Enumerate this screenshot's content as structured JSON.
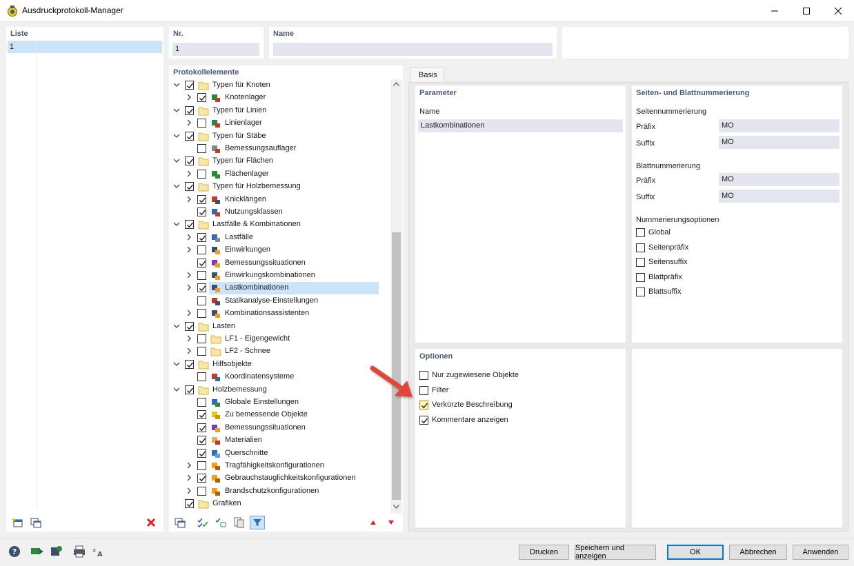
{
  "window": {
    "title": "Ausdruckprotokoll-Manager",
    "minimize_label": "—",
    "maximize_label": "☐",
    "close_label": "✕"
  },
  "liste": {
    "header": "Liste",
    "items": [
      "1"
    ]
  },
  "nr": {
    "header": "Nr.",
    "value": "1"
  },
  "name": {
    "header": "Name",
    "value": ""
  },
  "protokollelemente": {
    "header": "Protokollelemente",
    "tree": [
      {
        "label": "Typen für Knoten",
        "level": 0,
        "expand": "open",
        "checked": true,
        "icon": "folder-icon"
      },
      {
        "label": "Knotenlager",
        "level": 1,
        "expand": "closed",
        "checked": true,
        "icon": "node-support-icon"
      },
      {
        "label": "Typen für Linien",
        "level": 0,
        "expand": "open",
        "checked": true,
        "icon": "folder-icon"
      },
      {
        "label": "Linienlager",
        "level": 1,
        "expand": "closed",
        "checked": false,
        "icon": "line-support-icon"
      },
      {
        "label": "Typen für Stäbe",
        "level": 0,
        "expand": "open",
        "checked": true,
        "icon": "folder-icon"
      },
      {
        "label": "Bemessungsauflager",
        "level": 1,
        "expand": "none",
        "checked": false,
        "icon": "design-support-icon"
      },
      {
        "label": "Typen für Flächen",
        "level": 0,
        "expand": "open",
        "checked": true,
        "icon": "folder-icon"
      },
      {
        "label": "Flächenlager",
        "level": 1,
        "expand": "closed",
        "checked": false,
        "icon": "surface-support-icon"
      },
      {
        "label": "Typen für Holzbemessung",
        "level": 0,
        "expand": "open",
        "checked": true,
        "icon": "folder-icon"
      },
      {
        "label": "Knicklängen",
        "level": 1,
        "expand": "closed",
        "checked": true,
        "icon": "buckling-length-icon"
      },
      {
        "label": "Nutzungsklassen",
        "level": 1,
        "expand": "none",
        "checked": true,
        "icon": "service-class-icon"
      },
      {
        "label": "Lastfälle & Kombinationen",
        "level": 0,
        "expand": "open",
        "checked": true,
        "icon": "folder-icon"
      },
      {
        "label": "Lastfälle",
        "level": 1,
        "expand": "closed",
        "checked": true,
        "icon": "load-case-icon"
      },
      {
        "label": "Einwirkungen",
        "level": 1,
        "expand": "closed",
        "checked": false,
        "icon": "action-icon"
      },
      {
        "label": "Bemessungssituationen",
        "level": 1,
        "expand": "none",
        "checked": true,
        "icon": "design-situation-icon"
      },
      {
        "label": "Einwirkungskombinationen",
        "level": 1,
        "expand": "closed",
        "checked": false,
        "icon": "action-combination-icon"
      },
      {
        "label": "Lastkombinationen",
        "level": 1,
        "expand": "closed",
        "checked": true,
        "icon": "load-combination-icon",
        "selected": true
      },
      {
        "label": "Statikanalyse-Einstellungen",
        "level": 1,
        "expand": "none",
        "checked": false,
        "icon": "static-analysis-icon"
      },
      {
        "label": "Kombinationsassistenten",
        "level": 1,
        "expand": "closed",
        "checked": false,
        "icon": "combination-wizard-icon"
      },
      {
        "label": "Lasten",
        "level": 0,
        "expand": "open",
        "checked": true,
        "icon": "folder-icon"
      },
      {
        "label": "LF1 - Eigengewicht",
        "level": 1,
        "expand": "closed",
        "checked": false,
        "icon": "folder-icon"
      },
      {
        "label": "LF2 - Schnee",
        "level": 1,
        "expand": "closed",
        "checked": false,
        "icon": "folder-icon"
      },
      {
        "label": "Hilfsobjekte",
        "level": 0,
        "expand": "open",
        "checked": true,
        "icon": "folder-icon"
      },
      {
        "label": "Koordinatensysteme",
        "level": 1,
        "expand": "none",
        "checked": false,
        "icon": "coordinate-system-icon"
      },
      {
        "label": "Holzbemessung",
        "level": 0,
        "expand": "open",
        "checked": true,
        "icon": "folder-icon"
      },
      {
        "label": "Globale Einstellungen",
        "level": 1,
        "expand": "none",
        "checked": false,
        "icon": "globe-icon"
      },
      {
        "label": "Zu bemessende Objekte",
        "level": 1,
        "expand": "none",
        "checked": true,
        "icon": "objects-to-design-icon"
      },
      {
        "label": "Bemessungssituationen",
        "level": 1,
        "expand": "none",
        "checked": true,
        "icon": "design-situation-icon"
      },
      {
        "label": "Materialien",
        "level": 1,
        "expand": "none",
        "checked": true,
        "icon": "materials-icon"
      },
      {
        "label": "Querschnitte",
        "level": 1,
        "expand": "none",
        "checked": true,
        "icon": "cross-section-icon"
      },
      {
        "label": "Tragfähigkeitskonfigurationen",
        "level": 1,
        "expand": "closed",
        "checked": false,
        "icon": "uls-config-icon"
      },
      {
        "label": "Gebrauchstauglichkeitskonfigurationen",
        "level": 1,
        "expand": "closed",
        "checked": true,
        "icon": "sls-config-icon"
      },
      {
        "label": "Brandschutzkonfigurationen",
        "level": 1,
        "expand": "closed",
        "checked": false,
        "icon": "fire-config-icon"
      },
      {
        "label": "Grafiken",
        "level": 0,
        "expand": "none",
        "checked": true,
        "icon": "folder-icon"
      }
    ]
  },
  "tab": {
    "label": "Basis"
  },
  "parameter": {
    "header": "Parameter",
    "name_label": "Name",
    "name_value": "Lastkombinationen"
  },
  "numbering": {
    "header": "Seiten- und Blattnummerierung",
    "page_header": "Seitennummerierung",
    "page_prefix_label": "Präfix",
    "page_prefix_value": "MO",
    "page_suffix_label": "Suffix",
    "page_suffix_value": "MO",
    "sheet_header": "Blattnummerierung",
    "sheet_prefix_label": "Präfix",
    "sheet_prefix_value": "MO",
    "sheet_suffix_label": "Suffix",
    "sheet_suffix_value": "MO",
    "options_header": "Nummerierungsoptionen",
    "options": [
      {
        "label": "Global",
        "checked": false
      },
      {
        "label": "Seitenpräfix",
        "checked": false
      },
      {
        "label": "Seitensuffix",
        "checked": false
      },
      {
        "label": "Blattpräfix",
        "checked": false
      },
      {
        "label": "Blattsuffix",
        "checked": false
      }
    ]
  },
  "optionen": {
    "header": "Optionen",
    "items": [
      {
        "label": "Nur zugewiesene Objekte",
        "checked": false
      },
      {
        "label": "Filter",
        "checked": false
      },
      {
        "label": "Verkürzte Beschreibung",
        "checked": true,
        "highlight": true
      },
      {
        "label": "Kommentare anzeigen",
        "checked": true
      }
    ]
  },
  "buttons": {
    "print": "Drucken",
    "save_show": "Speichern und anzeigen",
    "ok": "OK",
    "cancel": "Abbrechen",
    "apply": "Anwenden"
  },
  "colors": {
    "accent": "#0078d7",
    "header_text": "#4a5a72",
    "field_bg": "#e4e6ef",
    "selection_bg": "#cce4f7",
    "arrow": "#e0473a"
  }
}
